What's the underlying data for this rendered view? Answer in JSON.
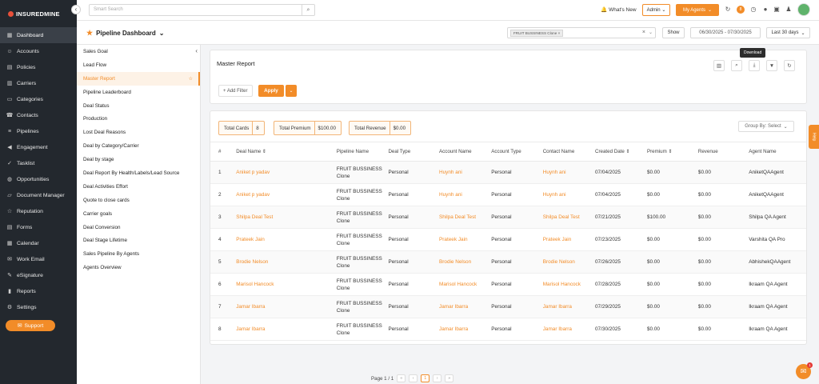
{
  "app": {
    "logo_text": "INSUREDMINE"
  },
  "sidebar": {
    "items": [
      {
        "label": "Dashboard",
        "icon": "grid-icon",
        "active": true
      },
      {
        "label": "Accounts",
        "icon": "user-icon"
      },
      {
        "label": "Policies",
        "icon": "document-icon"
      },
      {
        "label": "Carriers",
        "icon": "building-icon"
      },
      {
        "label": "Categories",
        "icon": "folder-icon"
      },
      {
        "label": "Contacts",
        "icon": "contact-icon"
      },
      {
        "label": "Pipelines",
        "icon": "pipeline-icon"
      },
      {
        "label": "Engagement",
        "icon": "megaphone-icon"
      },
      {
        "label": "Tasklist",
        "icon": "check-icon"
      },
      {
        "label": "Opportunities",
        "icon": "globe-icon"
      },
      {
        "label": "Document Manager",
        "icon": "folder-open-icon"
      },
      {
        "label": "Reputation",
        "icon": "star-icon"
      },
      {
        "label": "Forms",
        "icon": "form-icon"
      },
      {
        "label": "Calendar",
        "icon": "calendar-icon"
      },
      {
        "label": "Work Email",
        "icon": "mail-icon"
      },
      {
        "label": "eSignature",
        "icon": "pen-icon"
      },
      {
        "label": "Reports",
        "icon": "chart-icon"
      },
      {
        "label": "Settings",
        "icon": "gear-icon"
      }
    ],
    "support_label": "Support"
  },
  "topbar": {
    "search_placeholder": "Smart Search",
    "whats_new": "What's New",
    "admin_label": "Admin",
    "agents_label": "My Agents",
    "notification_count": "8"
  },
  "header": {
    "title": "Pipeline Dashboard",
    "filter_chip": "FRUIT BUSSINESS Clone",
    "show_label": "Show",
    "date_range": "06/30/2025 - 07/30/2025",
    "range_label": "Last 30 days"
  },
  "reports": {
    "items": [
      "Sales Goal",
      "Lead Flow",
      "Master Report",
      "Pipeline Leaderboard",
      "Deal Status",
      "Production",
      "Lost Deal Reasons",
      "Deal by Category/Carrier",
      "Deal by stage",
      "Deal Report By Health/Labels/Lead Source",
      "Deal Activities Effort",
      "Quote to close cards",
      "Carrier goals",
      "Deal Conversion",
      "Deal Stage Lifetime",
      "Sales Pipeline By Agents",
      "Agents Overview"
    ],
    "active_index": 2
  },
  "master": {
    "title": "Master Report",
    "tooltip": "Download",
    "add_filter": "+ Add Filter",
    "apply": "Apply",
    "summary": {
      "total_cards_label": "Total Cards",
      "total_cards_value": "8",
      "total_premium_label": "Total Premium",
      "total_premium_value": "$100.00",
      "total_revenue_label": "Total Revenue",
      "total_revenue_value": "$0.00"
    },
    "group_by": "Group By: Select",
    "columns": [
      "#",
      "Deal Name ⇕",
      "Pipeline Name",
      "Deal Type",
      "Account Name",
      "Account Type",
      "Contact Name",
      "Created Date ⇕",
      "Premium ⇕",
      "Revenue",
      "Agent Name"
    ],
    "rows": [
      [
        "1",
        "Aniket p yadav",
        "FRUIT BUSSINESS Clone",
        "Personal",
        "Huynh ani",
        "Personal",
        "Huynh ani",
        "07/04/2025",
        "$0.00",
        "$0.00",
        "AniketQAAgent"
      ],
      [
        "2",
        "Aniket p yadav",
        "FRUIT BUSSINESS Clone",
        "Personal",
        "Huynh ani",
        "Personal",
        "Huynh ani",
        "07/04/2025",
        "$0.00",
        "$0.00",
        "AniketQAAgent"
      ],
      [
        "3",
        "Shilpa Deal Test",
        "FRUIT BUSSINESS Clone",
        "Personal",
        "Shilpa Deal Test",
        "Personal",
        "Shilpa Deal Test",
        "07/21/2025",
        "$100.00",
        "$0.00",
        "Shilpa QA Agent"
      ],
      [
        "4",
        "Prateek Jain",
        "FRUIT BUSSINESS Clone",
        "Personal",
        "Prateek Jain",
        "Personal",
        "Prateek Jain",
        "07/23/2025",
        "$0.00",
        "$0.00",
        "Varshita QA Pro"
      ],
      [
        "5",
        "Brodie Nelson",
        "FRUIT BUSSINESS Clone",
        "Personal",
        "Brodie Nelson",
        "Personal",
        "Brodie Nelson",
        "07/26/2025",
        "$0.00",
        "$0.00",
        "AbhishekQAAgent"
      ],
      [
        "6",
        "Marisol Hancock",
        "FRUIT BUSSINESS Clone",
        "Personal",
        "Marisol Hancock",
        "Personal",
        "Marisol Hancock",
        "07/28/2025",
        "$0.00",
        "$0.00",
        "Ikraam QA Agent"
      ],
      [
        "7",
        "Jamar Ibarra",
        "FRUIT BUSSINESS Clone",
        "Personal",
        "Jamar Ibarra",
        "Personal",
        "Jamar Ibarra",
        "07/29/2025",
        "$0.00",
        "$0.00",
        "Ikraam QA Agent"
      ],
      [
        "8",
        "Jamar Ibarra",
        "FRUIT BUSSINESS Clone",
        "Personal",
        "Jamar Ibarra",
        "Personal",
        "Jamar Ibarra",
        "07/30/2025",
        "$0.00",
        "$0.00",
        "Ikraam QA Agent"
      ]
    ]
  },
  "pager": {
    "label": "Page 1 / 1",
    "current": "1"
  },
  "help_label": "Help",
  "chat_badge": "1",
  "colors": {
    "accent": "#f28c28",
    "sidebar_bg": "#23282e"
  }
}
